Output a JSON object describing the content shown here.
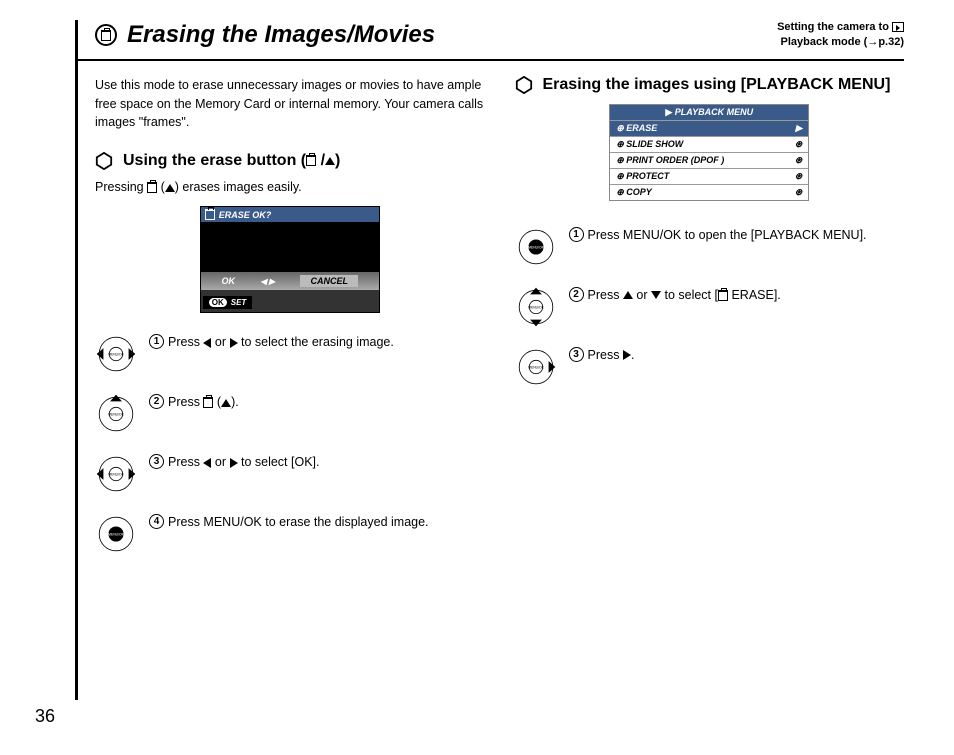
{
  "header": {
    "title": "Erasing the Images/Movies",
    "right_line1": "Setting the camera to ",
    "right_line2": "Playback mode (→p.32)"
  },
  "intro": "Use this mode to erase unnecessary images or movies to have ample free space on the Memory Card or internal memory. Your camera calls images \"frames\".",
  "left": {
    "section_title_prefix": "Using the erase button (",
    "section_title_suffix": ")",
    "sub_prefix": "Pressing ",
    "sub_suffix": ") erases images easily.",
    "screenshot": {
      "top_bar": "ERASE OK?",
      "ok": "OK",
      "cancel": "CANCEL",
      "set": "SET"
    },
    "steps": [
      {
        "num": "1",
        "prefix": "Press ",
        "mid": " or ",
        "suffix": " to select the erasing image.",
        "icons": [
          "left",
          "right"
        ]
      },
      {
        "num": "2",
        "prefix": "Press ",
        "mid": " (",
        "suffix": ").",
        "icons": [
          "trash",
          "up"
        ]
      },
      {
        "num": "3",
        "prefix": "Press ",
        "mid": " or ",
        "suffix": " to select [OK].",
        "icons": [
          "left",
          "right"
        ]
      },
      {
        "num": "4",
        "prefix": "Press MENU/OK to erase the displayed image.",
        "mid": "",
        "suffix": "",
        "icons": []
      }
    ]
  },
  "right": {
    "section_title": "Erasing the images using [PLAYBACK MENU]",
    "menu": {
      "header": "PLAYBACK MENU",
      "items": [
        {
          "label": "ERASE",
          "sel": true
        },
        {
          "label": "SLIDE SHOW",
          "sel": false
        },
        {
          "label": "PRINT ORDER (DPOF )",
          "sel": false
        },
        {
          "label": "PROTECT",
          "sel": false
        },
        {
          "label": "COPY",
          "sel": false
        }
      ]
    },
    "steps": [
      {
        "num": "1",
        "text": "Press MENU/OK to open the [PLAYBACK MENU]."
      },
      {
        "num": "2",
        "prefix": "Press ",
        "mid": " or ",
        "suffix": " to select [",
        "suffix2": " ERASE].",
        "icons": [
          "up",
          "down",
          "trash"
        ]
      },
      {
        "num": "3",
        "prefix": "Press ",
        "suffix": ".",
        "icons": [
          "right"
        ]
      }
    ]
  },
  "page_number": "36"
}
